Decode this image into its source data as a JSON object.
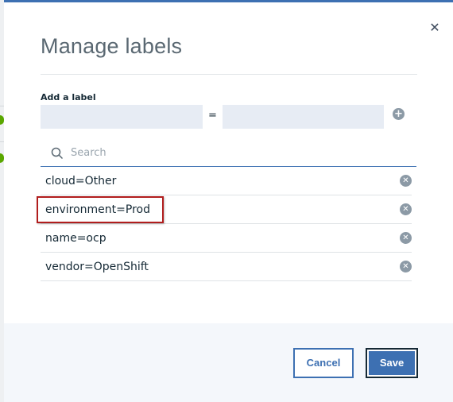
{
  "modal": {
    "title": "Manage labels",
    "close_icon": "close-icon"
  },
  "add_label": {
    "heading": "Add a label",
    "key_value": "",
    "value_value": "",
    "separator": "=",
    "add_icon": "add-circle-icon"
  },
  "search": {
    "placeholder": "Search",
    "icon": "search-icon"
  },
  "labels": [
    {
      "text": "cloud=Other",
      "remove_icon": "remove-circle-icon",
      "highlighted": false
    },
    {
      "text": "environment=Prod",
      "remove_icon": "remove-circle-icon",
      "highlighted": true
    },
    {
      "text": "name=ocp",
      "remove_icon": "remove-circle-icon",
      "highlighted": false
    },
    {
      "text": "vendor=OpenShift",
      "remove_icon": "remove-circle-icon",
      "highlighted": false
    }
  ],
  "footer": {
    "cancel_label": "Cancel",
    "save_label": "Save"
  },
  "colors": {
    "accent": "#3d70b2",
    "highlight_border": "#b11d1d",
    "input_background": "#e7ecf4",
    "footer_background": "#f4f7fb"
  }
}
